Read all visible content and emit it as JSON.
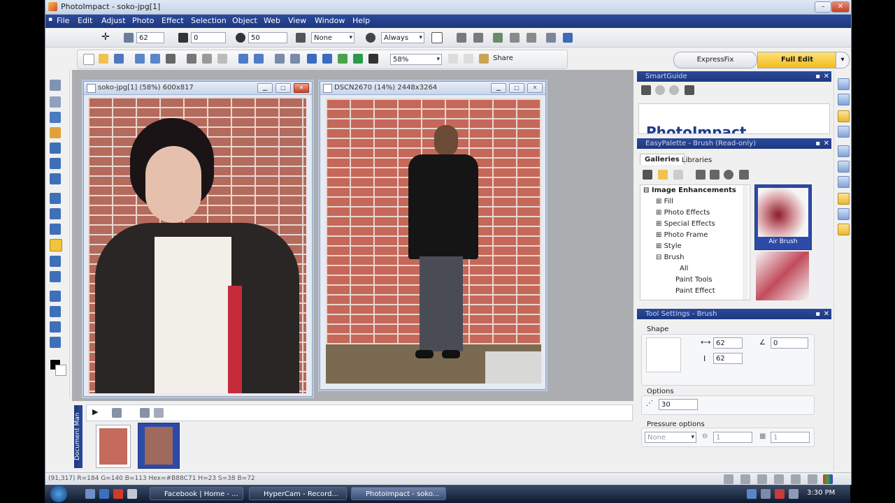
{
  "app": {
    "title": "PhotoImpact - soko-jpg[1]"
  },
  "menu": [
    "File",
    "Edit",
    "Adjust",
    "Photo",
    "Effect",
    "Selection",
    "Object",
    "Web",
    "View",
    "Window",
    "Help"
  ],
  "toolbar1": {
    "size": "62",
    "transparency": "0",
    "soft_edge": "50",
    "mode": "None",
    "merge": "Always"
  },
  "toolbar2": {
    "zoom": "58%",
    "share_label": "Share"
  },
  "tabs": {
    "expressfix": "ExpressFix",
    "fulledit": "Full Edit"
  },
  "doc1": {
    "title": "soko-jpg[1] (58%) 600x817"
  },
  "doc2": {
    "title": "DSCN2670 (14%) 2448x3264"
  },
  "document_manager": {
    "label": "Document Man"
  },
  "smartguide": {
    "title": "SmartGuide",
    "preview_text": "PhotoImpact"
  },
  "easypalette": {
    "title": "EasyPalette - Brush (Read-only)",
    "tabs": [
      "Galleries",
      "Libraries"
    ],
    "tree": [
      "Image Enhancements",
      "Fill",
      "Photo Effects",
      "Special Effects",
      "Photo Frame",
      "Style",
      "Brush",
      "All",
      "Paint Tools",
      "Paint Effect"
    ],
    "thumb_label": "Air Brush"
  },
  "toolsettings": {
    "title": "Tool Settings - Brush",
    "shape_label": "Shape",
    "width": "62",
    "height": "62",
    "angle": "0",
    "options_label": "Options",
    "options_value": "30",
    "pressure_label": "Pressure options",
    "pressure_mode": "None",
    "pressure_a": "1",
    "pressure_b": "1"
  },
  "status": {
    "text": "(91,317) R=184 G=140 B=113   Hex=#B88C71   H=23 S=38 B=72"
  },
  "taskbar": {
    "items": [
      "Facebook | Home - ...",
      "HyperCam - Record...",
      "PhotoImpact - soko..."
    ],
    "clock": "3:30 PM"
  },
  "colors": {
    "menu_blue": "#1e3880",
    "fulledit_gold": "#f7c62f",
    "panel_header": "#2c4a9a"
  }
}
